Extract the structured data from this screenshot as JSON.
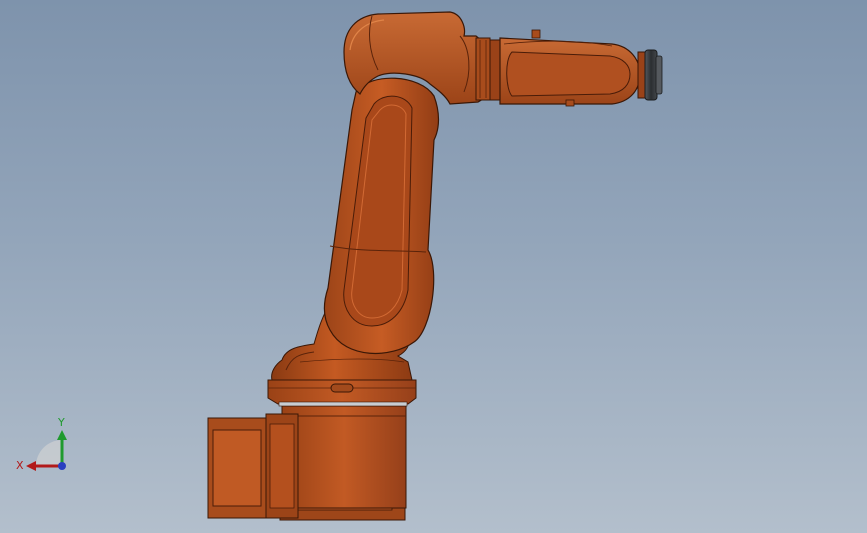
{
  "viewport": {
    "background_top": "#7e93ac",
    "background_bottom": "#b3bfcc"
  },
  "robot": {
    "body_color": "#b4501c",
    "highlight_color": "#d06a30",
    "shadow_color": "#7d3210",
    "outline_color": "#3a1706",
    "flange_color": "#2e3134"
  },
  "triad": {
    "x_label": "X",
    "y_label": "Y",
    "x_color": "#b21a1a",
    "y_color": "#1f9a2e",
    "z_color": "#2a3fc0"
  }
}
